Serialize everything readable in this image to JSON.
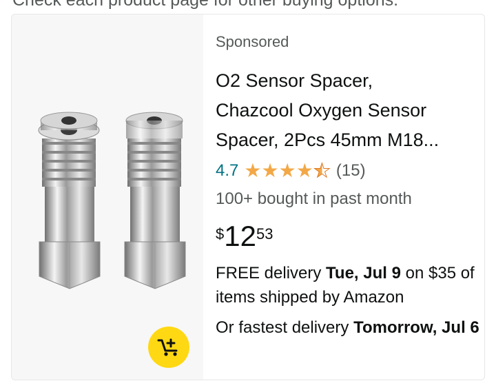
{
  "header": {
    "cut_text": "Check each product page for other buying options."
  },
  "product": {
    "sponsored_label": "Sponsored",
    "title_lines": [
      "O2 Sensor Spacer,",
      "Chazcool Oxygen Sensor",
      "Spacer, 2Pcs 45mm M18..."
    ],
    "rating": "4.7",
    "rating_value": 4.7,
    "review_count": "(15)",
    "bought_text": "100+ bought in past month",
    "price": {
      "symbol": "$",
      "whole": "12",
      "fraction": "53"
    },
    "delivery": {
      "prefix": "FREE delivery ",
      "date": "Tue, Jul 9",
      "suffix": " on $35 of items shipped by Amazon"
    },
    "fastest": {
      "prefix": "Or fastest delivery ",
      "date": "Tomorrow, Jul 6"
    },
    "image_icon": "product-image",
    "cart_icon": "add-to-cart-icon",
    "colors": {
      "star": "#f3a847",
      "rating_link": "#007185",
      "cart_button": "#ffd814"
    }
  }
}
